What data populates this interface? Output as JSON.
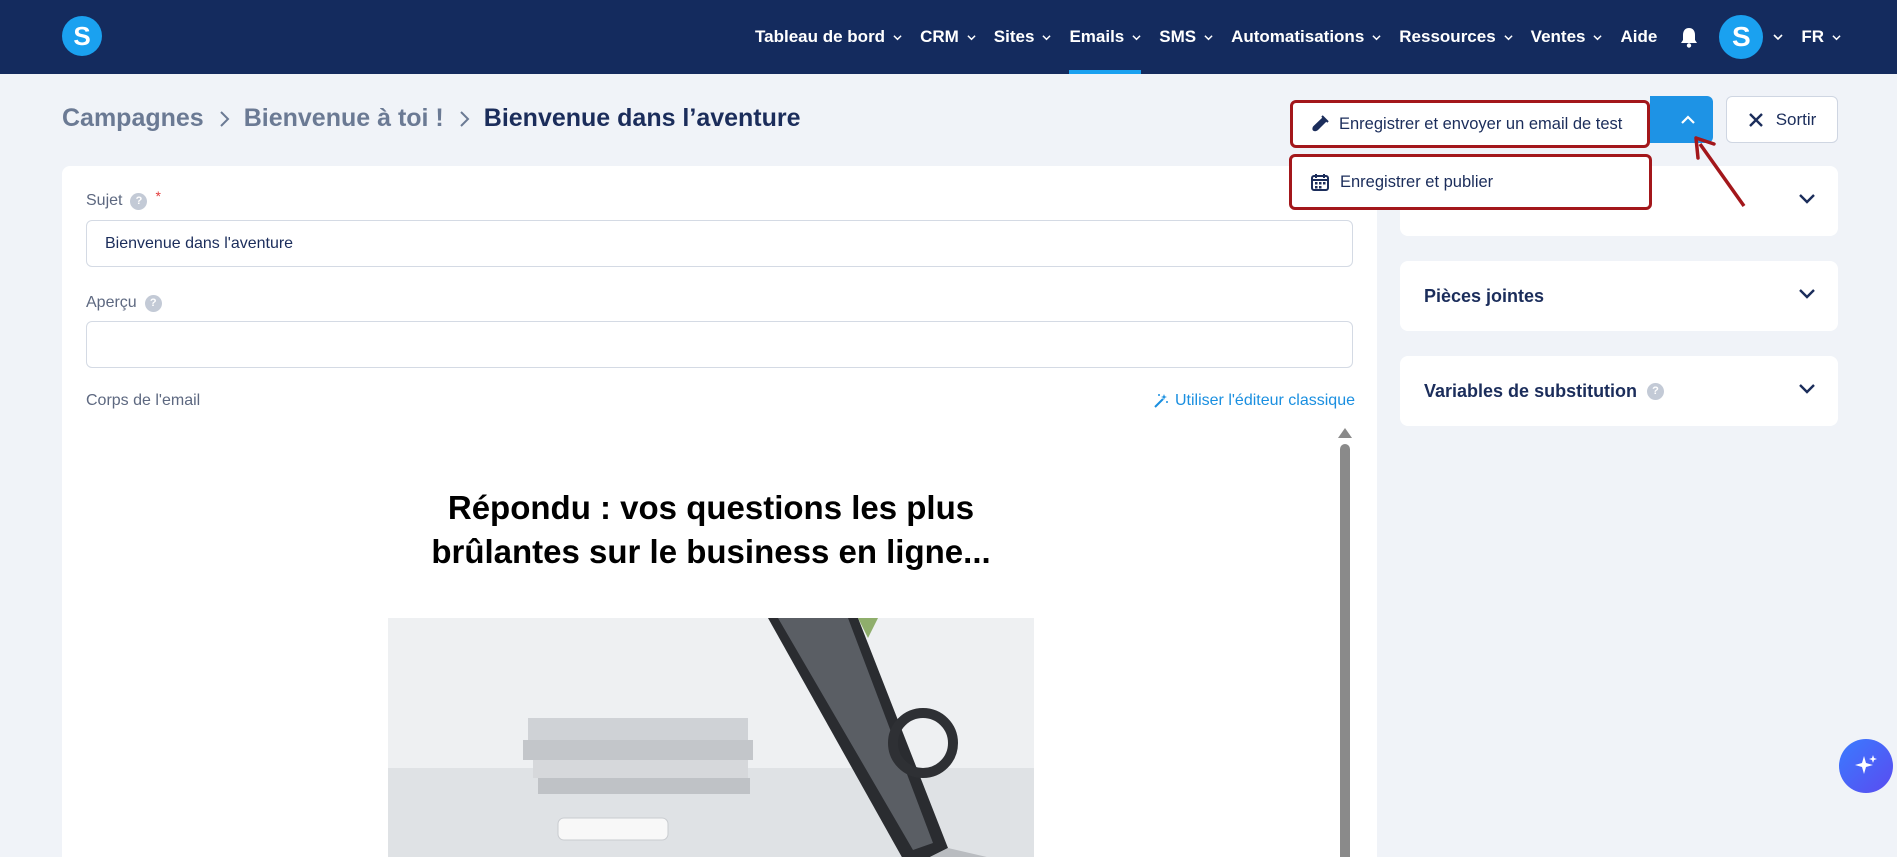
{
  "brand": {
    "logo_letter": "S"
  },
  "nav": {
    "items": [
      {
        "label": "Tableau de bord",
        "has_menu": true,
        "active": false
      },
      {
        "label": "CRM",
        "has_menu": true,
        "active": false
      },
      {
        "label": "Sites",
        "has_menu": true,
        "active": false
      },
      {
        "label": "Emails",
        "has_menu": true,
        "active": true
      },
      {
        "label": "SMS",
        "has_menu": true,
        "active": false
      },
      {
        "label": "Automatisations",
        "has_menu": true,
        "active": false
      },
      {
        "label": "Ressources",
        "has_menu": true,
        "active": false
      },
      {
        "label": "Ventes",
        "has_menu": true,
        "active": false
      },
      {
        "label": "Aide",
        "has_menu": false,
        "active": false
      }
    ],
    "avatar_letter": "S",
    "language": "FR"
  },
  "breadcrumb": {
    "items": [
      "Campagnes",
      "Bienvenue à toi !",
      "Bienvenue dans l’aventure"
    ]
  },
  "actions": {
    "save_test_label": "Enregistrer et envoyer un email de test",
    "save_publish_label": "Enregistrer et publier",
    "exit_label": "Sortir"
  },
  "form": {
    "subject_label": "Sujet",
    "subject_required_mark": "*",
    "subject_value": "Bienvenue dans l'aventure",
    "preview_label": "Aperçu",
    "preview_value": "",
    "body_label": "Corps de l'email",
    "classic_editor_link": "Utiliser l'éditeur classique",
    "help_glyph": "?"
  },
  "email_content": {
    "heading_line1": "Répondu : vos questions les plus",
    "heading_line2": "brûlantes sur le business en ligne..."
  },
  "panels": [
    {
      "label": "",
      "help": false
    },
    {
      "label": "Pièces jointes",
      "help": false
    },
    {
      "label": "Variables de substitution",
      "help": true
    }
  ],
  "colors": {
    "nav_bg": "#142b5e",
    "accent": "#1aa1f0",
    "primary_button": "#1e93e5",
    "annotation_red": "#a3171b",
    "page_bg": "#f0f3f8"
  }
}
